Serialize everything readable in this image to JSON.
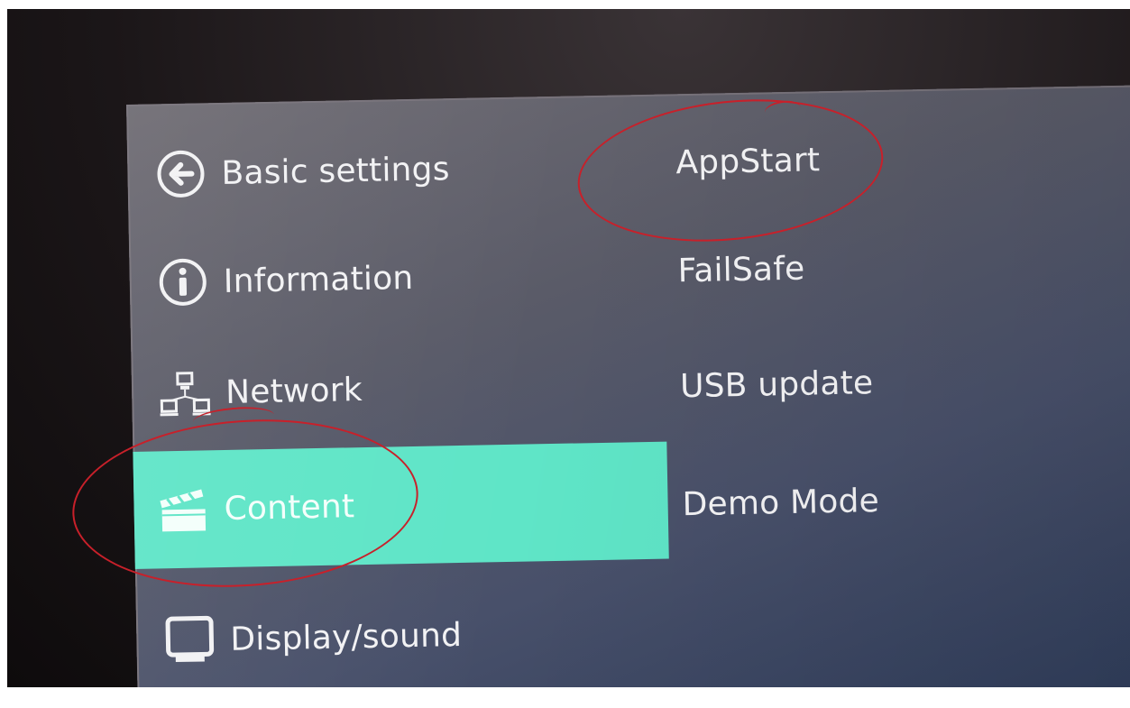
{
  "left_menu": {
    "items": [
      {
        "label": "Basic settings",
        "icon": "back-arrow-circle-icon"
      },
      {
        "label": "Information",
        "icon": "info-circle-icon"
      },
      {
        "label": "Network",
        "icon": "network-icon"
      },
      {
        "label": "Content",
        "icon": "clapperboard-icon",
        "selected": true
      },
      {
        "label": "Display/sound",
        "icon": "monitor-icon"
      }
    ]
  },
  "right_menu": {
    "items": [
      {
        "label": "AppStart"
      },
      {
        "label": "FailSafe"
      },
      {
        "label": "USB update"
      },
      {
        "label": "Demo Mode"
      }
    ]
  },
  "colors": {
    "selection": "#5fe5c7",
    "annotation": "#c8202a"
  }
}
